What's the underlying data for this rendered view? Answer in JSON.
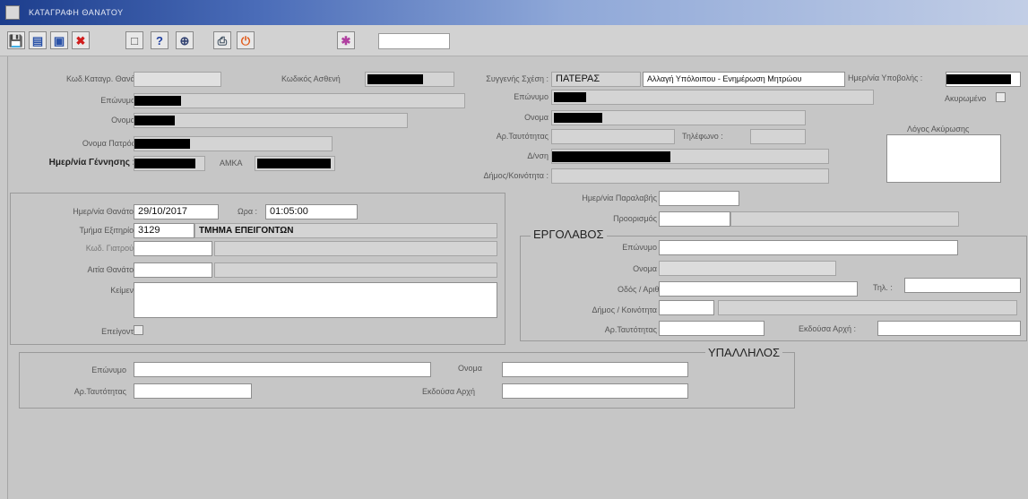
{
  "titlebar": {
    "title": "ΚΑΤΑΓΡΑΦΗ ΘΑΝΑΤΟΥ"
  },
  "toolbar": {
    "buttons": [
      {
        "name": "save-button",
        "icon": "save-icon",
        "glyph": "💾",
        "color": "#1a4fa0"
      },
      {
        "name": "enter-query-button",
        "icon": "enter-query-icon",
        "glyph": "▤",
        "color": "#2a52a8"
      },
      {
        "name": "execute-query-button",
        "icon": "execute-query-icon",
        "glyph": "▣",
        "color": "#2a52a8"
      },
      {
        "name": "delete-button",
        "icon": "delete-icon",
        "glyph": "✖",
        "color": "#d01c1c"
      },
      {
        "name": "new-record-button",
        "icon": "new-document-icon",
        "glyph": "□",
        "color": "#444444"
      },
      {
        "name": "help-button",
        "icon": "help-icon",
        "glyph": "?",
        "color": "#2040a0"
      },
      {
        "name": "zoom-button",
        "icon": "zoom-icon",
        "glyph": "⊕",
        "color": "#304070"
      },
      {
        "name": "print-button",
        "icon": "print-icon",
        "glyph": "⎙",
        "color": "#405060"
      },
      {
        "name": "exit-button",
        "icon": "exit-icon",
        "glyph": "⏻",
        "color": "#e05a1a"
      },
      {
        "name": "palette-button",
        "icon": "palette-icon",
        "glyph": "✱",
        "color": "#b040a0"
      }
    ],
    "field_value": ""
  },
  "patient": {
    "death_code_label": "Κωδ.Καταγρ. Θανάτου",
    "death_code_value": "",
    "patient_code_label": "Κωδικός Ασθενή",
    "surname_label": "Επώνυμο",
    "name_label": "Ονομα",
    "father_name_label": "Ονομα Πατρός",
    "birth_date_label": "Ημερ/νία Γέννησης :",
    "amka_label": "ΑΜΚΑ"
  },
  "relative": {
    "relation_label": "Συγγενής Σχέση :",
    "relation_value": "ΠΑΤΕΡΑΣ",
    "change_button": "Αλλαγή Υπόλοιπου - Ενημέρωση Μητρώου",
    "submit_date_label": "Ημερ/νία Υποβολής :",
    "cancelled_label": "Ακυρωμένο",
    "surname_label": "Επώνυμο",
    "name_label": "Ονομα",
    "id_number_label": "Αρ.Ταυτότητας",
    "phone_label": "Τηλέφωνο :",
    "address_label": "Δ/νση",
    "municipality_label": "Δήμος/Κοινότητα :",
    "id_number_value": "",
    "phone_value": "",
    "municipality_value": "",
    "cancel_reason_label": "Λόγος Ακύρωσης",
    "cancel_reason_value": ""
  },
  "death": {
    "date_label": "Ημερ/νία Θανάτου",
    "date_value": "29/10/2017",
    "time_label": "Ωρα :",
    "time_value": "01:05:00",
    "department_label": "Τμήμα Εξιτηρίου",
    "department_code": "3129",
    "department_name": "ΤΜΗΜΑ ΕΠΕΙΓΟΝΤΩΝ",
    "doctor_code_label": "Κωδ. Γιατρού :",
    "doctor_code_value": "",
    "doctor_name_value": "",
    "cause_label": "Αιτία Θανάτου",
    "cause_code_value": "",
    "cause_desc_value": "",
    "text_label": "Κείμενο",
    "text_value": "",
    "urgent_label": "Επείγοντα"
  },
  "contractor": {
    "delivery_date_label": "Ημερ/νία Παραλαβής :",
    "delivery_date_value": "",
    "destination_label": "Προορισμός :",
    "destination_code": "",
    "destination_desc": "",
    "title": "ΕΡΓΟΛΑΒΟΣ",
    "surname_label": "Επώνυμο :",
    "surname_value": "",
    "name_label": "Ονομα :",
    "name_value": "",
    "street_label": "Οδός / Αριθ.",
    "street_value": "",
    "phone_label": "Τηλ. :",
    "phone_value": "",
    "municipality_label": "Δήμος / Κοινότητα :",
    "municipality_code": "",
    "municipality_name": "",
    "id_label": "Αρ.Ταυτότητας :",
    "id_value": "",
    "issuing_label": "Εκδούσα Αρχή :",
    "issuing_value": ""
  },
  "employee": {
    "title": "ΥΠΑΛΛΗΛΟΣ",
    "surname_label": "Επώνυμο",
    "surname_value": "",
    "name_label": "Ονομα",
    "name_value": "",
    "id_label": "Αρ.Ταυτότητας",
    "id_value": "",
    "issuing_label": "Εκδούσα Αρχή",
    "issuing_value": ""
  }
}
